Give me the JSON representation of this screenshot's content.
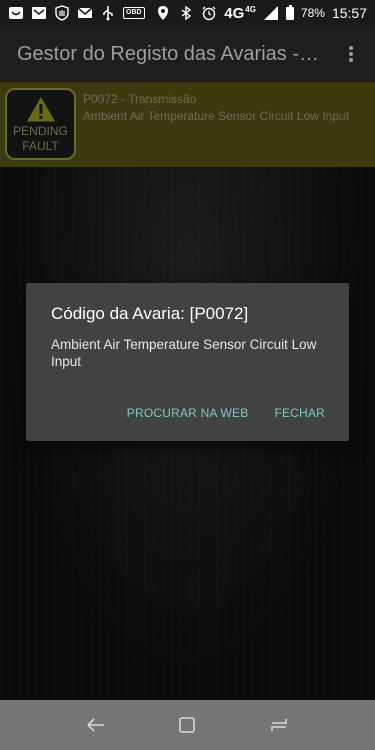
{
  "status_bar": {
    "icons_left": [
      "smiley-icon",
      "mail-icon",
      "shield-hand-icon",
      "gmail-icon",
      "usb-icon",
      "obd-icon"
    ],
    "obd_label": "OBD",
    "icons_right": [
      "location-icon",
      "bluetooth-icon",
      "alarm-icon"
    ],
    "network": "4G",
    "network_small": "4G",
    "battery_percent": "78%",
    "time": "15:57"
  },
  "app_bar": {
    "title": "Gestor do Registo das Avarias -…",
    "menu_icon": "overflow-menu-icon"
  },
  "fault_list": [
    {
      "badge_line1": "PENDING",
      "badge_line2": "FAULT",
      "code_line": "P0072 - Transmissão",
      "description": "Ambient Air Temperature Sensor Circuit Low Input"
    }
  ],
  "dialog": {
    "title": "Código da Avaria: [P0072]",
    "message": "Ambient Air Temperature Sensor Circuit Low Input",
    "search_button": "PROCURAR NA WEB",
    "close_button": "FECHAR"
  },
  "nav_bar": {
    "buttons": [
      "back-icon",
      "home-square-icon",
      "recents-icon"
    ]
  },
  "colors": {
    "dialog_bg": "#424242",
    "accent_button": "#7fcbc4",
    "fault_row_bg": "#3c3a0e",
    "nav_bar_bg": "#767676"
  }
}
